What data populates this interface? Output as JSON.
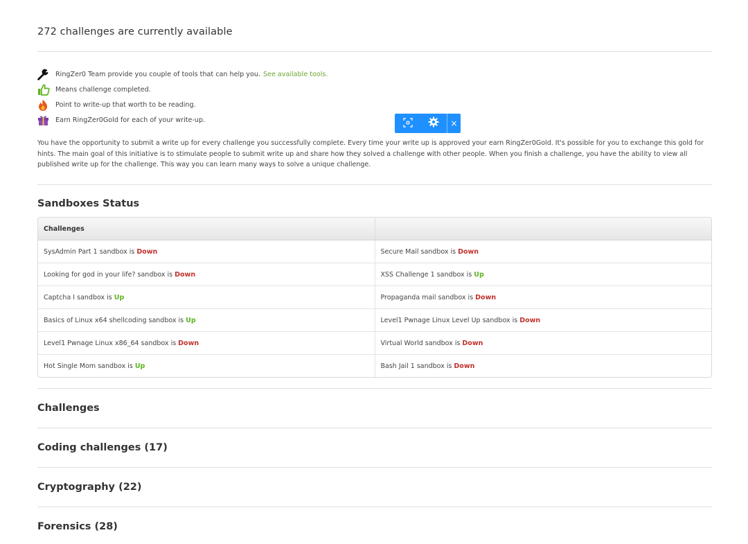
{
  "header": {
    "count_text": "272 challenges are currently available"
  },
  "legend": {
    "items": [
      {
        "icon": "wrench-icon",
        "text": "RingZer0 Team provide you couple of tools that can help you.",
        "link": "See available tools."
      },
      {
        "icon": "thumbs-up-icon",
        "text": "Means challenge completed.",
        "link": ""
      },
      {
        "icon": "fire-icon",
        "text": "Point to write-up that worth to be reading.",
        "link": ""
      },
      {
        "icon": "gift-icon",
        "text": "Earn RingZer0Gold for each of your write-up.",
        "link": ""
      }
    ]
  },
  "intro_text": "You have the opportunity to submit a write up for every challenge you successfully complete. Every time your write up is approved your earn RingZer0Gold. It's possible for you to exchange this gold for hints. The main goal of this initiative is to stimulate people to submit write up and share how they solved a challenge with other people. When you finish a challenge, you have the ability to view all published write up for the challenge. This way you can learn many ways to solve a unique challenge.",
  "sandboxes": {
    "title": "Sandboxes Status",
    "header": "Challenges",
    "rows": [
      [
        {
          "name": "SysAdmin Part 1 sandbox is",
          "status": "Down"
        },
        {
          "name": "Secure Mail sandbox is",
          "status": "Down"
        }
      ],
      [
        {
          "name": "Looking for god in your life? sandbox is",
          "status": "Down"
        },
        {
          "name": "XSS Challenge 1 sandbox is",
          "status": "Up"
        }
      ],
      [
        {
          "name": "Captcha I sandbox is",
          "status": "Up"
        },
        {
          "name": "Propaganda mail sandbox is",
          "status": "Down"
        }
      ],
      [
        {
          "name": "Basics of Linux x64 shellcoding sandbox is",
          "status": "Up"
        },
        {
          "name": "Level1 Pwnage Linux Level Up sandbox is",
          "status": "Down"
        }
      ],
      [
        {
          "name": "Level1 Pwnage Linux x86_64 sandbox is",
          "status": "Down"
        },
        {
          "name": "Virtual World sandbox is",
          "status": "Down"
        }
      ],
      [
        {
          "name": "Hot Single Mom sandbox is",
          "status": "Up"
        },
        {
          "name": "Bash Jail 1 sandbox is",
          "status": "Down"
        }
      ]
    ]
  },
  "challenges": {
    "title": "Challenges",
    "categories": [
      {
        "name": "Coding challenges",
        "count": "(17)"
      },
      {
        "name": "Cryptography",
        "count": "(22)"
      },
      {
        "name": "Forensics",
        "count": "(28)"
      }
    ]
  },
  "toolbar": {
    "buttons": [
      "screenshot-icon",
      "gear-icon",
      "close-icon"
    ],
    "close_label": "×"
  },
  "colors": {
    "link": "#6aa82e",
    "down": "#c0312d",
    "up": "#5fb321",
    "toolbar": "#1e90ff"
  }
}
